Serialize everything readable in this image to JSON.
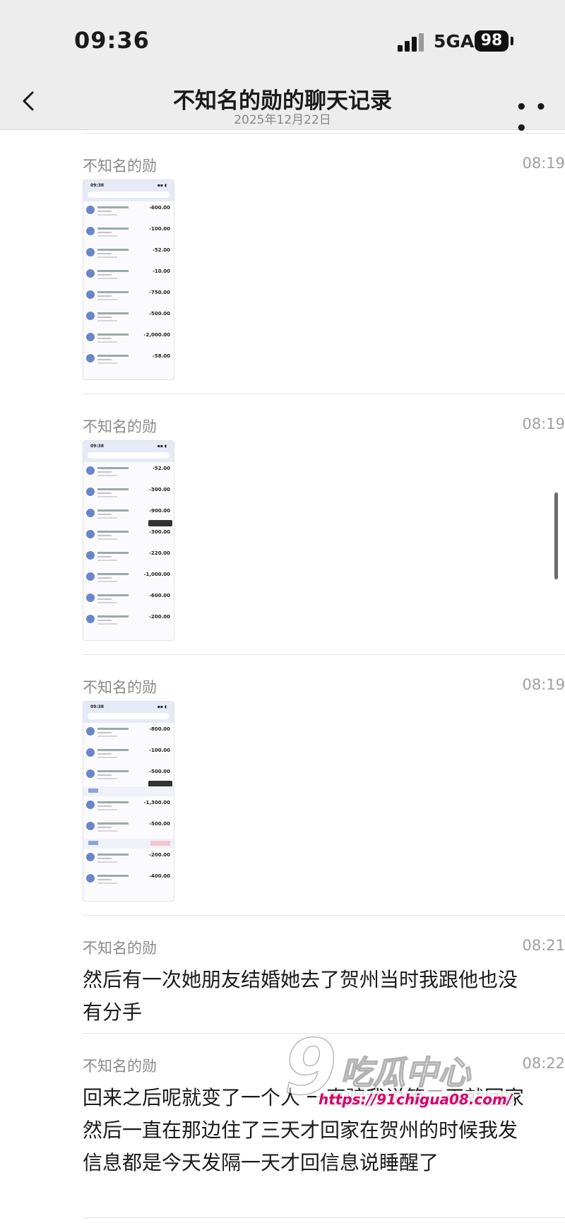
{
  "status_bar": {
    "time": "09:36",
    "network": "5GA",
    "battery": "98"
  },
  "nav": {
    "title": "不知名的勋的聊天记录",
    "date": "2025年12月22日"
  },
  "messages": [
    {
      "sender": "不知名的勋",
      "time": "08:19",
      "type": "image",
      "image": {
        "time": "09:38",
        "tip_label": "",
        "amounts": [
          "-600.00",
          "-100.00",
          "-52.00",
          "-10.00",
          "-750.00",
          "-500.00",
          "-2,000.00",
          "-58.00"
        ]
      }
    },
    {
      "sender": "不知名的勋",
      "time": "08:19",
      "type": "image",
      "image": {
        "time": "09:38",
        "amounts": [
          "-52.00",
          "-300.00",
          "-900.00",
          "-300.00",
          "-220.00",
          "-1,000.00",
          "-600.00",
          "-200.00"
        ]
      }
    },
    {
      "sender": "不知名的勋",
      "time": "08:19",
      "type": "image",
      "image": {
        "time": "09:38",
        "amounts": [
          "-800.00",
          "-100.00",
          "-500.00",
          "-1,300.00",
          "-500.00",
          "-200.00",
          "-400.00"
        ]
      }
    },
    {
      "sender": "不知名的勋",
      "time": "08:21",
      "type": "text",
      "text": "然后有一次她朋友结婚她去了贺州当时我跟他也没有分手"
    },
    {
      "sender": "不知名的勋",
      "time": "08:22",
      "type": "text",
      "text": "回来之后呢就变了一个人 一直骗我说第二天就回家然后一直在那边住了三天才回家在贺州的时候我发信息都是今天发隔一天才回信息说睡醒了"
    }
  ],
  "watermark": {
    "number": "9",
    "text": "吃瓜中心",
    "url": "https://91chigua08.com/"
  },
  "icons": {
    "back": "chevron-left-icon",
    "more": "more-dots-icon",
    "signal": "signal-icon",
    "battery": "battery-icon"
  }
}
